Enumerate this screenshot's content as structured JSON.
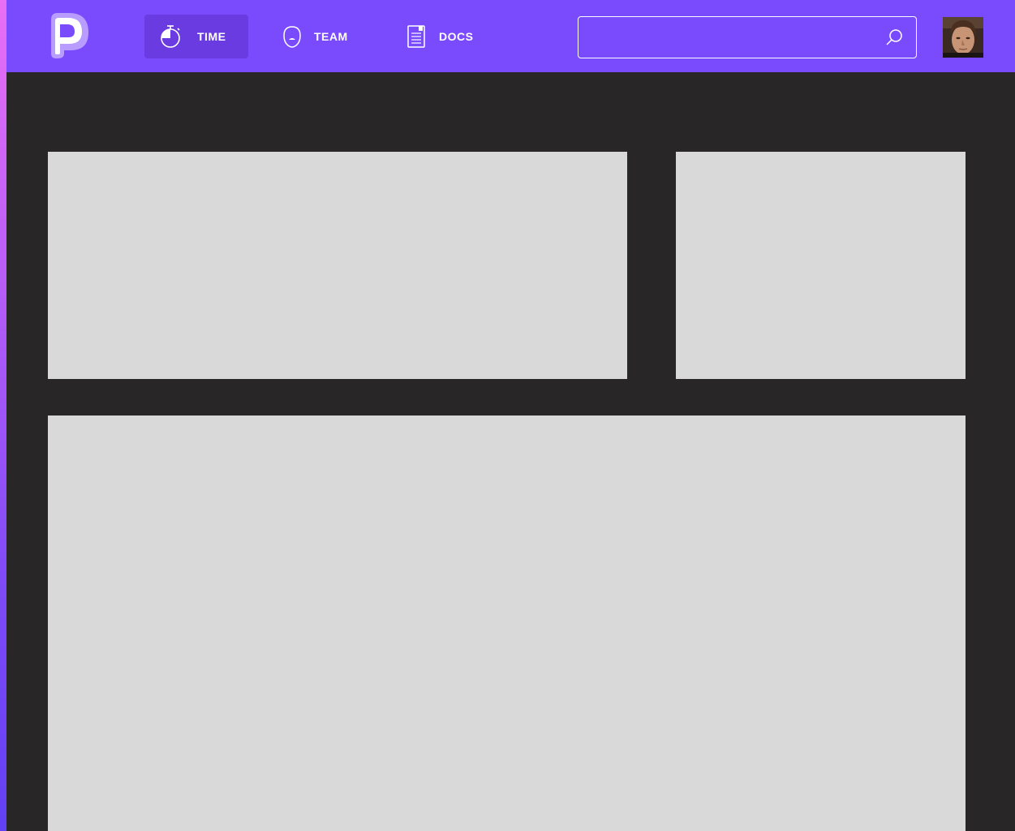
{
  "nav": {
    "items": [
      {
        "label": "TIME",
        "icon": "stopwatch-icon",
        "active": true
      },
      {
        "label": "TEAM",
        "icon": "head-icon",
        "active": false
      },
      {
        "label": "DOCS",
        "icon": "document-icon",
        "active": false
      }
    ]
  },
  "search": {
    "value": "",
    "placeholder": ""
  },
  "colors": {
    "topbar": "#7a4afd",
    "active_nav": "#6a3be0",
    "background": "#282627",
    "panel": "#d9d9d9"
  }
}
